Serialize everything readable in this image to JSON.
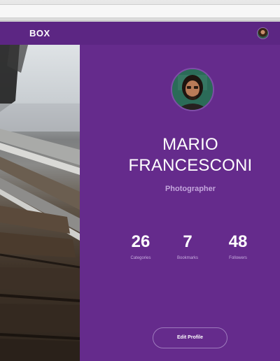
{
  "app": {
    "brand": "BOX"
  },
  "profile": {
    "name_line1": "MARIO",
    "name_line2": "FRANCESCONI",
    "role": "Photographer",
    "stats": [
      {
        "value": "26",
        "label": "Categories"
      },
      {
        "value": "7",
        "label": "Bookmarks"
      },
      {
        "value": "48",
        "label": "Followers"
      }
    ],
    "edit_label": "Edit Profile"
  },
  "colors": {
    "accent": "#652b8c",
    "topbar": "#5c2683",
    "muted_text": "#c4a6dc"
  }
}
